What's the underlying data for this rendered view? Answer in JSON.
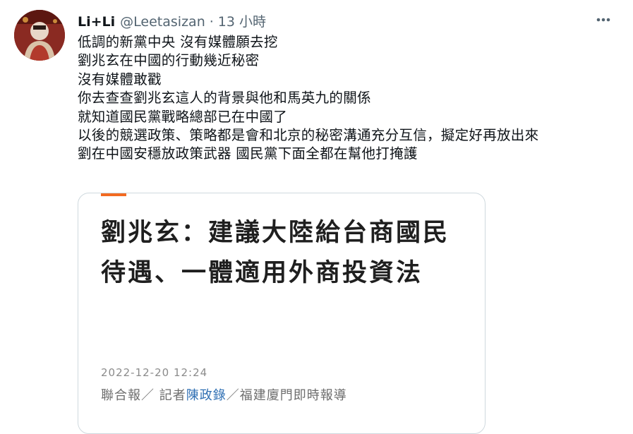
{
  "tweet": {
    "avatar_icon": "profile-avatar",
    "display_name": "Li+Li",
    "handle": "@Leetasizan",
    "separator": "·",
    "timestamp": "13 小時",
    "more_icon": "more-horizontal-icon",
    "body_lines": [
      "低調的新黨中央  沒有媒體願去挖",
      "劉兆玄在中國的行動幾近秘密",
      "沒有媒體敢戳",
      "你去查查劉兆玄這人的背景與他和馬英九的關係",
      "就知道國民黨戰略總部已在中國了",
      "以後的競選政策、策略都是會和北京的秘密溝通充分互信，擬定好再放出來",
      "劉在中國安穩放政策武器 國民黨下面全都在幫他打掩護"
    ]
  },
  "card": {
    "accent_color": "#f26a21",
    "headline": "劉兆玄：建議大陸給台商國民待遇、一體適用外商投資法",
    "date": "2022-12-20 12:24",
    "source_outlet": "聯合報／ 記者",
    "source_reporter": "陳政錄",
    "source_suffix": "／福建廈門即時報導"
  }
}
